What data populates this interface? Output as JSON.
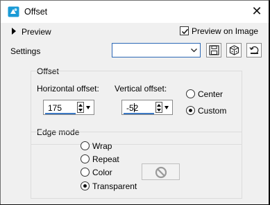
{
  "window": {
    "title": "Offset",
    "close": "✕"
  },
  "top": {
    "preview_label": "Preview",
    "preview_on_image_label": "Preview on Image",
    "preview_on_image_checked": true
  },
  "settings": {
    "label": "Settings",
    "value": ""
  },
  "offset": {
    "title": "Offset",
    "horizontal_label": "Horizontal offset:",
    "horizontal_value": "175",
    "vertical_label": "Vertical offset:",
    "vertical_value": "-52",
    "options": [
      "Center",
      "Custom"
    ],
    "selected": "Custom"
  },
  "edge": {
    "title": "Edge mode",
    "options": [
      "Wrap",
      "Repeat",
      "Color",
      "Transparent"
    ],
    "selected": "Transparent"
  },
  "icons": [
    "offset-app-icon",
    "chevron-down-icon",
    "save-icon",
    "dice-icon",
    "reset-icon",
    "prohibited-icon"
  ]
}
